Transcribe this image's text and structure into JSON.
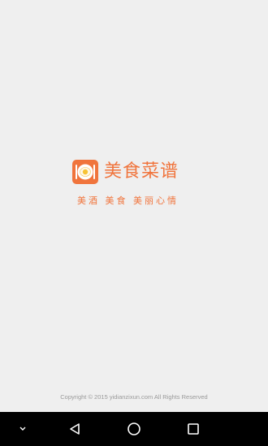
{
  "app": {
    "title": "美食菜谱",
    "slogan": "美酒 美食 美丽心情",
    "brand_color": "#f0743c"
  },
  "footer": {
    "copyright": "Copyright © 2015 yidianzixun.com All Rights Reserved"
  },
  "navigation_bar": {
    "buttons": [
      {
        "icon": "chevron-down-icon"
      },
      {
        "icon": "back-triangle-icon"
      },
      {
        "icon": "home-circle-icon"
      },
      {
        "icon": "recents-square-icon"
      }
    ]
  }
}
